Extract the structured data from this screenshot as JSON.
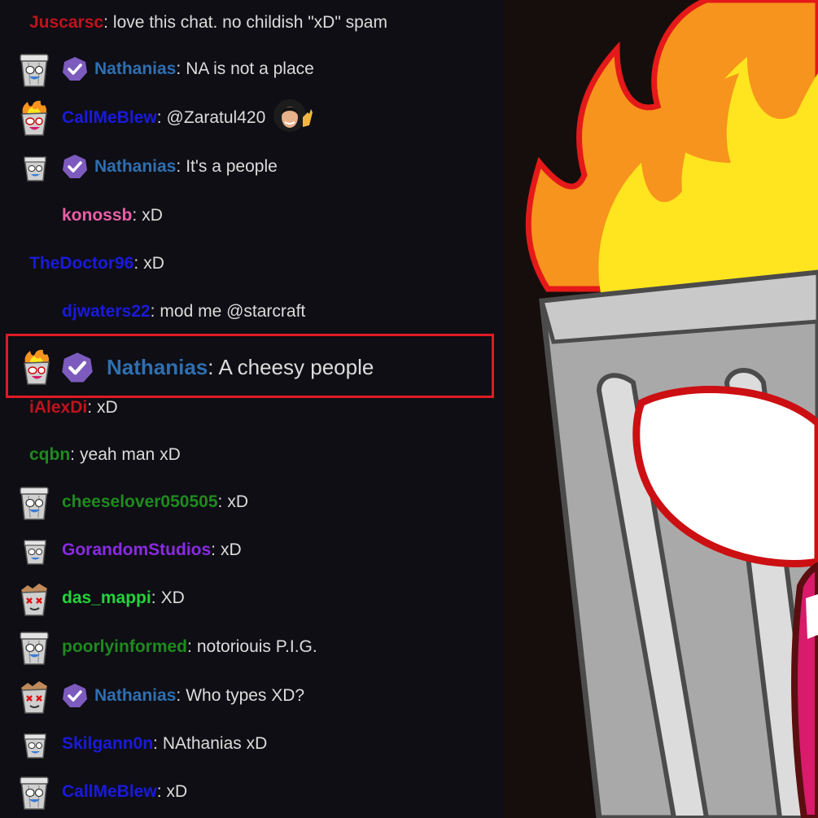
{
  "chat": {
    "messages": [
      {
        "user": "Juscarsc",
        "color": "#c0121d",
        "text": "love this chat. no childish \"xD\" spam",
        "avatar": "none",
        "badge": false
      },
      {
        "user": "Nathanias",
        "color": "#2f6fb0",
        "text": "NA is not a place",
        "avatar": "trashcan-emote",
        "badge": true
      },
      {
        "user": "CallMeBlew",
        "color": "#1a1adc",
        "text": "@Zaratul420",
        "avatar": "flaming-trashcan-emote",
        "badge": false,
        "emote": "waving-woman-emote"
      },
      {
        "user": "Nathanias",
        "color": "#2f6fb0",
        "text": "It's a people",
        "avatar": "small-trashcan-emote",
        "badge": true
      },
      {
        "user": "konossb",
        "color": "#e85fa6",
        "text": "xD",
        "avatar": "none",
        "badge": false
      },
      {
        "user": "TheDoctor96",
        "color": "#1a1adc",
        "text": "xD",
        "avatar": "none",
        "badge": false
      },
      {
        "user": "djwaters22",
        "color": "#1a1adc",
        "text": "mod me @starcraft",
        "avatar": "none",
        "badge": false
      },
      {
        "user": "iAlexDi",
        "color": "#c0121d",
        "text": "xD",
        "avatar": "none",
        "badge": false
      },
      {
        "user": "cqbn",
        "color": "#1f8a1f",
        "text": "yeah man xD",
        "avatar": "none",
        "badge": false
      },
      {
        "user": "cheeselover050505",
        "color": "#1f8a1f",
        "text": "xD",
        "avatar": "trashcan-emote",
        "badge": false
      },
      {
        "user": "GorandomStudios",
        "color": "#8a2be2",
        "text": "xD",
        "avatar": "small-trashcan-emote",
        "badge": false
      },
      {
        "user": "das_mappi",
        "color": "#22d33a",
        "text": "XD",
        "avatar": "dead-trashcan-emote",
        "badge": false
      },
      {
        "user": "poorlyinformed",
        "color": "#1f8a1f",
        "text": "notoriouis P.I.G.",
        "avatar": "trashcan-emote",
        "badge": false
      },
      {
        "user": "Nathanias",
        "color": "#2f6fb0",
        "text": "Who types XD?",
        "avatar": "dead-trashcan-emote",
        "badge": true
      },
      {
        "user": "Skilgann0n",
        "color": "#1a1adc",
        "text": "NAthanias xD",
        "avatar": "small-trashcan-emote",
        "badge": false
      },
      {
        "user": "CallMeBlew",
        "color": "#1a1adc",
        "text": "xD",
        "avatar": "trashcan-emote",
        "badge": false
      }
    ],
    "highlighted": {
      "user": "Nathanias",
      "color": "#2f6fb0",
      "text": "A cheesy people",
      "avatar": "flaming-trashcan-emote",
      "badge": true
    }
  },
  "colors": {
    "badge": "#7d5bbe",
    "highlight_border": "#e01a22",
    "flame_orange": "#f7941d",
    "flame_yellow": "#ffe51f",
    "can_gray": "#b8b8b8"
  }
}
